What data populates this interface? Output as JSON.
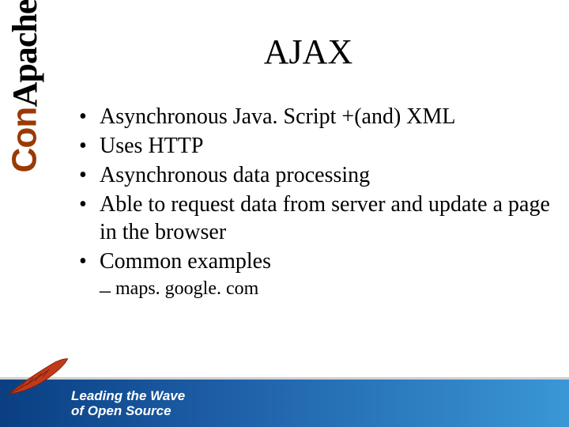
{
  "sidebar": {
    "brand_part1": "Apache",
    "brand_part2": "Con"
  },
  "slide": {
    "title": "AJAX",
    "bullets": [
      "Asynchronous Java. Script +(and) XML",
      "Uses HTTP",
      "Asynchronous data processing",
      "Able to request data from server and update a page in the browser",
      "Common examples"
    ],
    "sub_bullets": [
      "maps. google. com"
    ]
  },
  "footer": {
    "tagline_line1": "Leading the Wave",
    "tagline_line2": "of Open Source"
  }
}
